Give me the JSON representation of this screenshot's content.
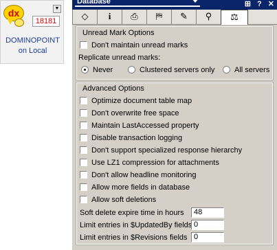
{
  "left_card": {
    "logo_text": "dx",
    "code": "18181",
    "server_name": "DOMINOPOINT",
    "location": "on Local"
  },
  "panel": {
    "title": "Database",
    "tabs": [
      {
        "icon": "eraser-icon",
        "glyph": "◇"
      },
      {
        "icon": "info-icon",
        "glyph": "i"
      },
      {
        "icon": "printer-icon",
        "glyph": "⎙"
      },
      {
        "icon": "design-icon",
        "glyph": "⛿"
      },
      {
        "icon": "key-icon",
        "glyph": "✎"
      },
      {
        "icon": "search-icon",
        "glyph": "⚲"
      },
      {
        "icon": "advanced-icon",
        "glyph": "⚖"
      }
    ],
    "active_tab": 6
  },
  "unread_section": {
    "title": "Unread Mark Options",
    "dont_maintain_label": "Don't maintain unread marks",
    "replicate_label": "Replicate unread marks:",
    "radio_options": [
      "Never",
      "Clustered servers only",
      "All servers"
    ],
    "selected_option": "Never"
  },
  "advanced_section": {
    "title": "Advanced Options",
    "checkboxes": [
      "Optimize document table map",
      "Don't overwrite free space",
      "Maintain LastAccessed property",
      "Disable transaction logging",
      "Don't support specialized response hierarchy",
      "Use LZ1 compression for attachments",
      "Don't allow headline monitoring",
      "Allow more fields in database",
      "Allow soft deletions"
    ],
    "fields": [
      {
        "label": "Soft delete expire time in hours",
        "value": "48"
      },
      {
        "label": "Limit entries in $UpdatedBy fields",
        "value": "0"
      },
      {
        "label": "Limit entries in $Revisions fields",
        "value": "0"
      }
    ]
  }
}
